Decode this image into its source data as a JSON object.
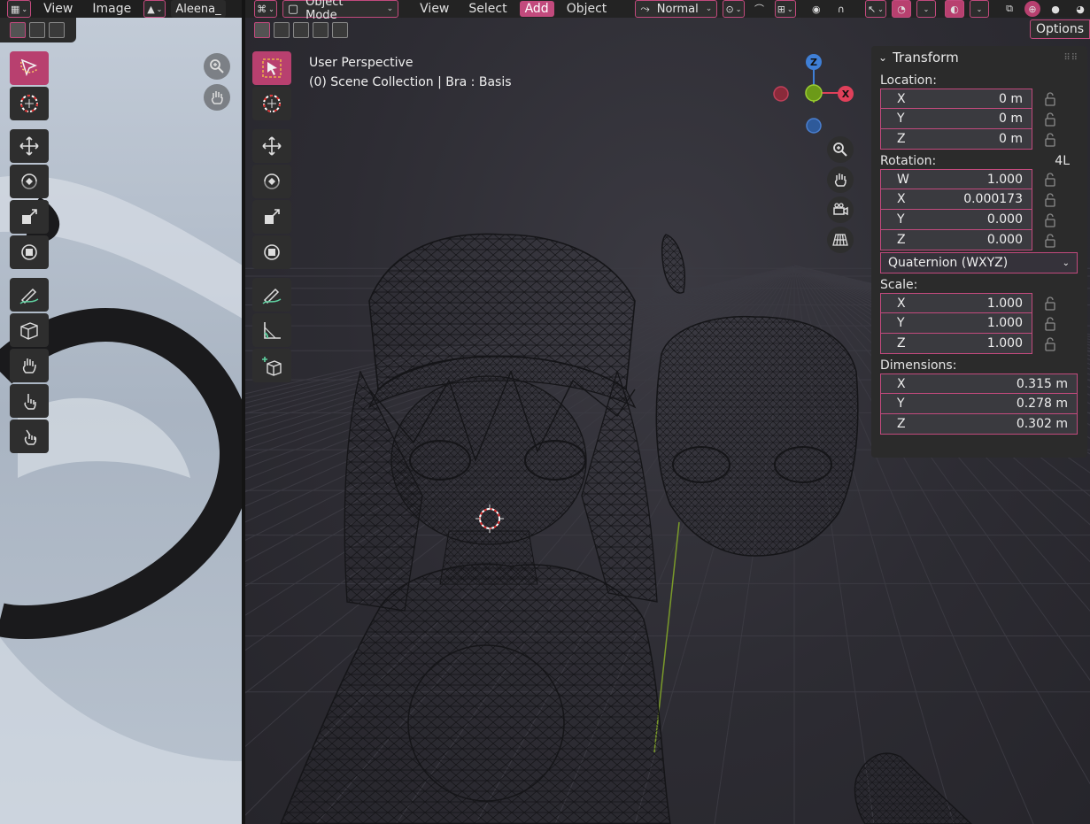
{
  "image_editor": {
    "header": {
      "view_label": "View",
      "image_label": "Image",
      "image_name": "Aleena_"
    }
  },
  "viewport": {
    "header": {
      "mode": "Object Mode",
      "menus": [
        "View",
        "Select",
        "Add",
        "Object"
      ],
      "active_menu": "Add",
      "orientation": "Normal"
    },
    "overlay": {
      "perspective": "User Perspective",
      "collection": "(0) Scene Collection | Bra : Basis"
    },
    "options_label": "Options",
    "gizmo_axes": {
      "z": "Z",
      "x": "X"
    },
    "colors": {
      "accent": "#c24a7d",
      "axis_x": "#e0405a",
      "axis_y": "#7aa81e",
      "axis_z": "#3f7fd6"
    }
  },
  "transform": {
    "title": "Transform",
    "location_label": "Location:",
    "location": [
      {
        "axis": "X",
        "value": "0 m"
      },
      {
        "axis": "Y",
        "value": "0 m"
      },
      {
        "axis": "Z",
        "value": "0 m"
      }
    ],
    "rotation_label": "Rotation:",
    "rotation_extra": "4L",
    "rotation": [
      {
        "axis": "W",
        "value": "1.000"
      },
      {
        "axis": "X",
        "value": "0.000173"
      },
      {
        "axis": "Y",
        "value": "0.000"
      },
      {
        "axis": "Z",
        "value": "0.000"
      }
    ],
    "rotation_mode": "Quaternion (WXYZ)",
    "scale_label": "Scale:",
    "scale": [
      {
        "axis": "X",
        "value": "1.000"
      },
      {
        "axis": "Y",
        "value": "1.000"
      },
      {
        "axis": "Z",
        "value": "1.000"
      }
    ],
    "dimensions_label": "Dimensions:",
    "dimensions": [
      {
        "axis": "X",
        "value": "0.315 m"
      },
      {
        "axis": "Y",
        "value": "0.278 m"
      },
      {
        "axis": "Z",
        "value": "0.302 m"
      }
    ]
  }
}
